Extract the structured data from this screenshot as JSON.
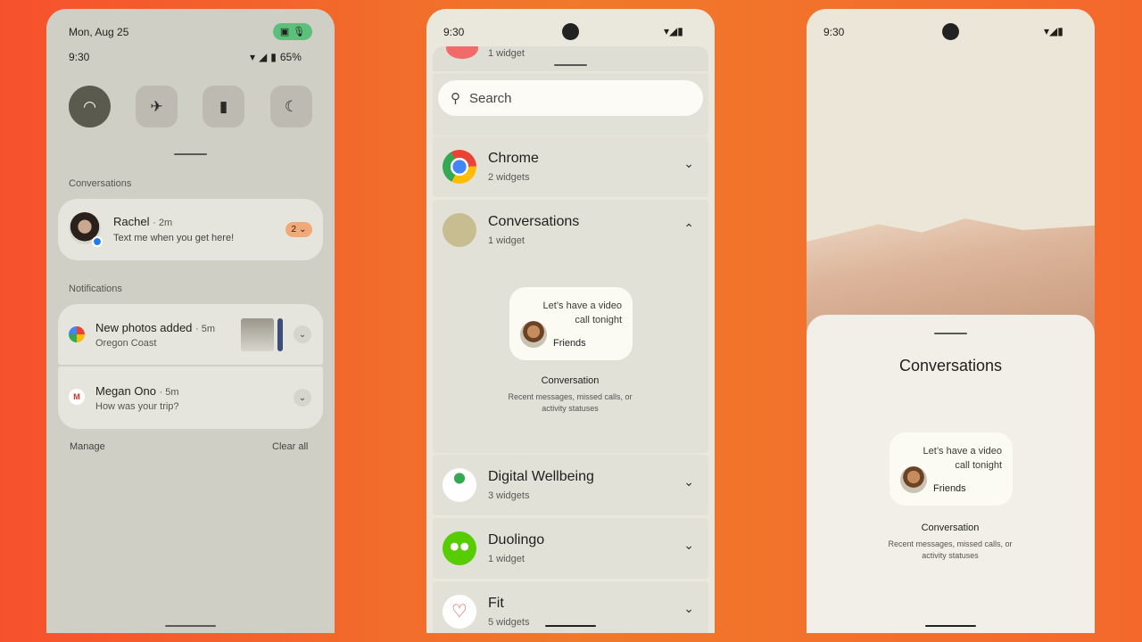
{
  "background_colors": [
    "#f6512d",
    "#f0792a"
  ],
  "panel1": {
    "date": "Mon, Aug 25",
    "time": "9:30",
    "battery": "65%",
    "privacy_indicator": {
      "color": "#5cbf7a",
      "icons": [
        "camera-icon",
        "mic-icon"
      ]
    },
    "quick_tiles": [
      {
        "icon": "wifi-icon",
        "active": true
      },
      {
        "icon": "airplane-icon",
        "active": false
      },
      {
        "icon": "battery-saver-icon",
        "active": false
      },
      {
        "icon": "dark-mode-icon",
        "active": false
      }
    ],
    "conversations_label": "Conversations",
    "conversation": {
      "name": "Rachel",
      "time": "2m",
      "message": "Text me when you get here!",
      "count": "2",
      "badge_color": "#f1a978"
    },
    "notifications_label": "Notifications",
    "notifications": [
      {
        "title": "New photos added",
        "time": "5m",
        "text": "Oregon Coast",
        "icon": "google-photos-icon"
      },
      {
        "title": "Megan Ono",
        "time": "5m",
        "text": "How was your trip?",
        "icon": "gmail-icon"
      }
    ],
    "manage": "Manage",
    "clear_all": "Clear all"
  },
  "panel2": {
    "time": "9:30",
    "top_partial": "1 widget",
    "search_placeholder": "Search",
    "apps": [
      {
        "name": "Chrome",
        "count": "2 widgets",
        "expanded": false
      },
      {
        "name": "Conversations",
        "count": "1 widget",
        "expanded": true
      },
      {
        "name": "Digital Wellbeing",
        "count": "3 widgets",
        "expanded": false
      },
      {
        "name": "Duolingo",
        "count": "1 widget",
        "expanded": false
      },
      {
        "name": "Fit",
        "count": "5 widgets",
        "expanded": false
      }
    ],
    "widget": {
      "message": "Let’s have a video call tonight",
      "contact": "Friends",
      "title": "Conversation",
      "description": "Recent messages, missed calls, or activity statuses"
    }
  },
  "panel3": {
    "time": "9:30",
    "sheet_title": "Conversations",
    "widget": {
      "message": "Let’s have a video call tonight",
      "contact": "Friends",
      "title": "Conversation",
      "description": "Recent messages, missed calls, or activity statuses"
    }
  }
}
